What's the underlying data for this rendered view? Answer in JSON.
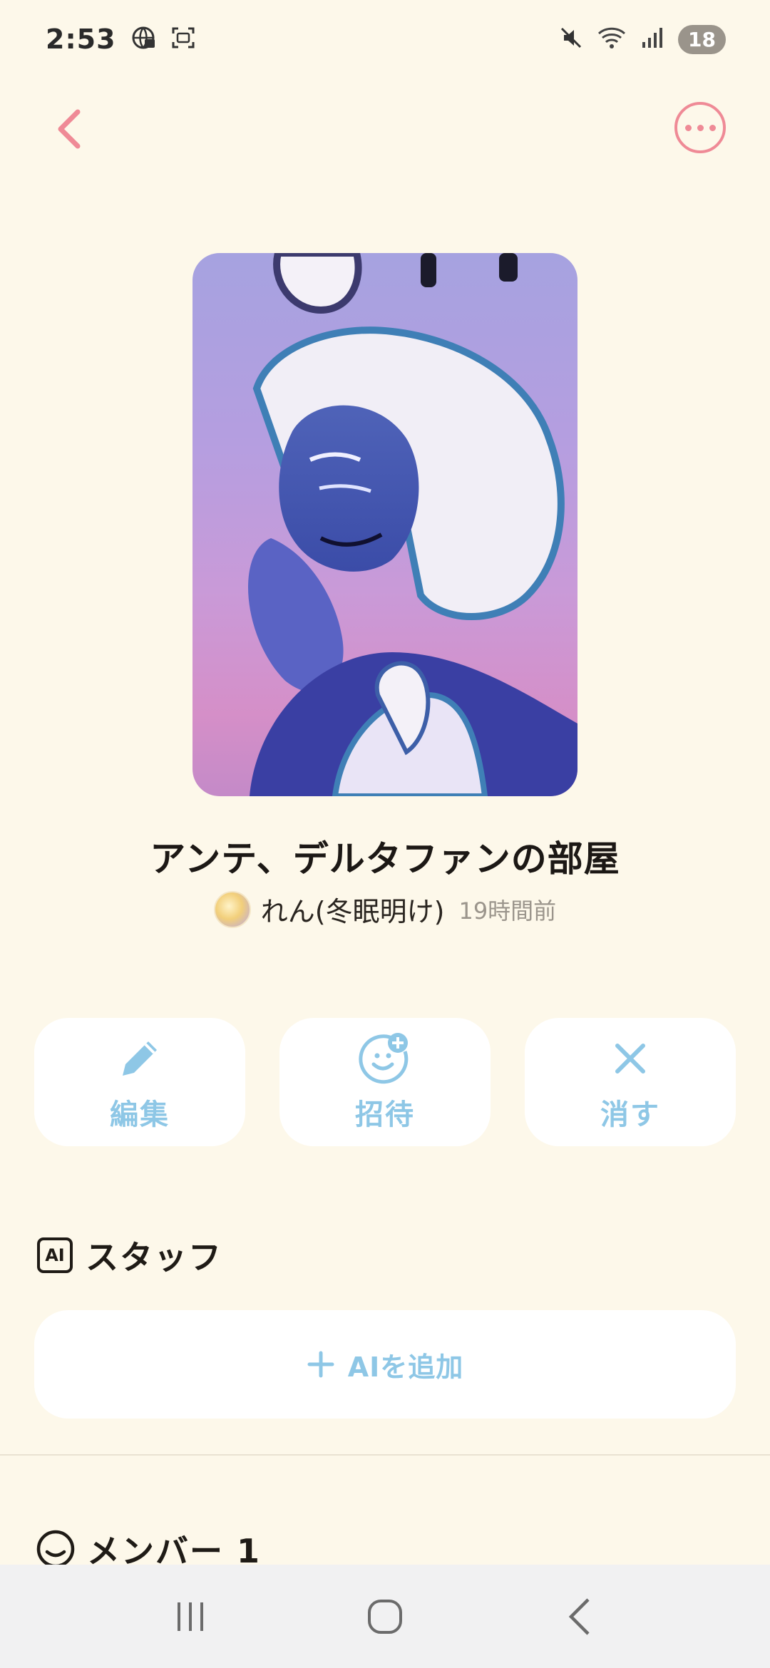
{
  "status_bar": {
    "time": "2:53",
    "battery": "18",
    "icons": [
      "vpn-globe-icon",
      "screenshot-icon",
      "mute-icon",
      "wifi-icon",
      "signal-icon"
    ]
  },
  "nav": {
    "back_icon": "chevron-left-icon",
    "more_icon": "more-horizontal-icon"
  },
  "room": {
    "title": "アンテ、デルタファンの部屋",
    "creator_name": "れん(冬眠明け)",
    "time_ago": "19時間前"
  },
  "actions": [
    {
      "label": "編集",
      "icon": "pencil-icon"
    },
    {
      "label": "招待",
      "icon": "smile-plus-icon"
    },
    {
      "label": "消す",
      "icon": "close-icon"
    }
  ],
  "staff": {
    "badge": "AI",
    "title": "スタッフ",
    "add_label": "AIを追加"
  },
  "members": {
    "title": "メンバー 1"
  },
  "colors": {
    "background": "#fdf8ea",
    "accent_pink": "#ef8a96",
    "accent_blue": "#8ec7e6",
    "card": "#ffffff"
  }
}
